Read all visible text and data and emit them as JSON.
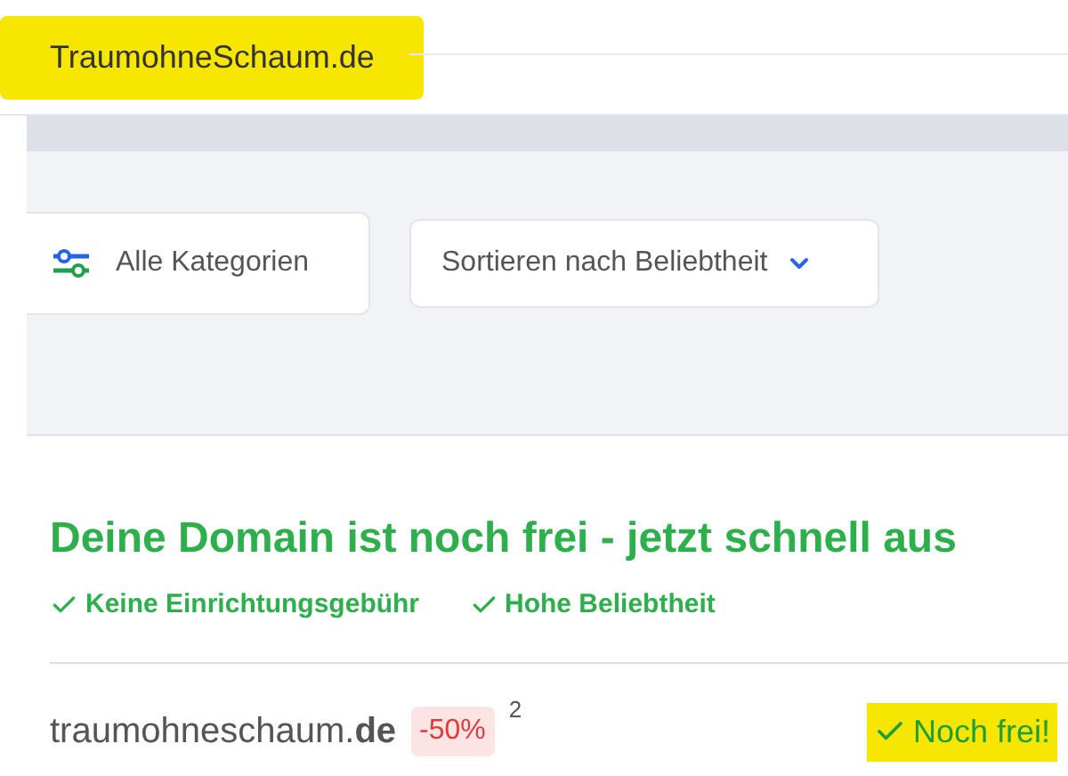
{
  "site_title": {
    "text": "TraumohneSchaum.de",
    "highlighted": true
  },
  "filters": {
    "category_button": "Alle Kategorien",
    "sort_select": "Sortieren nach Beliebtheit"
  },
  "offer": {
    "heading": "Deine Domain ist noch frei - jetzt schnell aus",
    "features": [
      "Keine Einrichtungsgebühr",
      "Hohe Beliebtheit"
    ],
    "domain": {
      "name": "traumohneschaum.**de**",
      "discount": "-50%",
      "footnote": "2",
      "status": "Noch frei!",
      "highlighted": true
    }
  }
}
